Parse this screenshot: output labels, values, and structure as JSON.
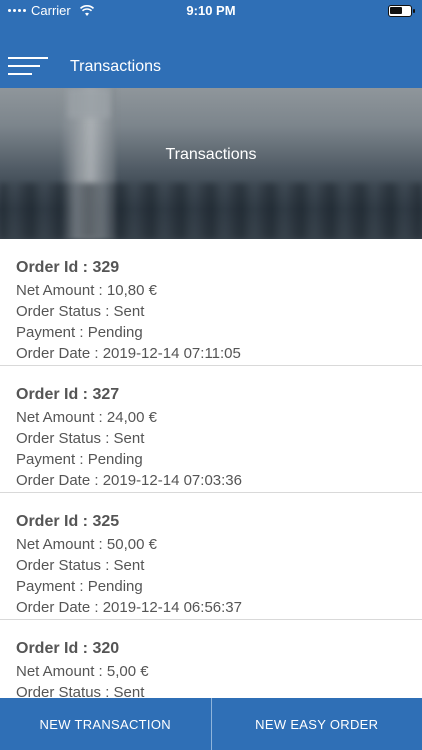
{
  "status_bar": {
    "carrier": "Carrier",
    "time": "9:10 PM"
  },
  "header": {
    "title": "Transactions",
    "menu_icon": "hamburger-menu-icon"
  },
  "banner": {
    "title": "Transactions"
  },
  "orders": [
    {
      "id": "Order Id : 329",
      "net_amount": "Net Amount : 10,80 €",
      "status": "Order Status : Sent",
      "payment": "Payment : Pending",
      "date": "Order Date : 2019-12-14 07:11:05"
    },
    {
      "id": "Order Id : 327",
      "net_amount": "Net Amount : 24,00 €",
      "status": "Order Status : Sent",
      "payment": "Payment : Pending",
      "date": "Order Date : 2019-12-14 07:03:36"
    },
    {
      "id": "Order Id : 325",
      "net_amount": "Net Amount : 50,00 €",
      "status": "Order Status : Sent",
      "payment": "Payment : Pending",
      "date": "Order Date : 2019-12-14 06:56:37"
    },
    {
      "id": "Order Id : 320",
      "net_amount": "Net Amount : 5,00 €",
      "status": "Order Status : Sent",
      "payment": "",
      "date": ""
    }
  ],
  "bottom_bar": {
    "new_transaction": "NEW TRANSACTION",
    "new_easy_order": "NEW EASY ORDER"
  },
  "colors": {
    "brand_blue": "#2f6fb6",
    "text_gray": "#555555"
  }
}
